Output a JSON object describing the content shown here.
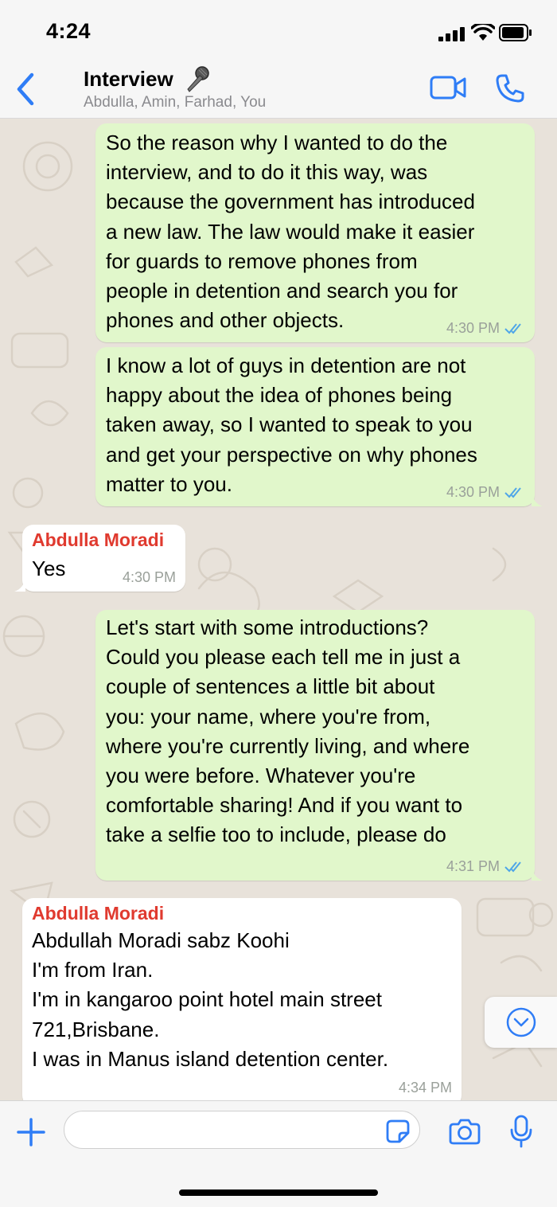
{
  "status_bar": {
    "time": "4:24"
  },
  "header": {
    "back_icon": "chevron-left-icon",
    "title": "Interview",
    "title_emoji_icon": "microphone-icon",
    "subtitle": "Abdulla, Amin, Farhad, You",
    "video_icon": "video-camera-icon",
    "call_icon": "phone-icon"
  },
  "messages": [
    {
      "direction": "outgoing",
      "text": "So the reason why I wanted to do the\ninterview, and to do it this way, was\nbecause the government has introduced\na new law. The law would make it easier\nfor guards to remove phones from\npeople in detention and search you for\nphones and other objects.",
      "time": "4:30 PM",
      "status": "read"
    },
    {
      "direction": "outgoing",
      "text": "I know a lot of guys in detention are not\nhappy about the idea of phones being\ntaken away, so I wanted to speak to you\nand get your perspective on why phones\nmatter to you.",
      "time": "4:30 PM",
      "status": "read"
    },
    {
      "direction": "incoming",
      "sender": "Abdulla Moradi",
      "text": "Yes",
      "time": "4:30 PM"
    },
    {
      "direction": "outgoing",
      "text": "Let's start with some introductions?\nCould you please each tell me in just a\ncouple of sentences a little bit about\nyou: your name, where you're from,\nwhere you're currently living, and where\nyou were before. Whatever you're\ncomfortable sharing! And if you want to\ntake a selfie too to include, please do",
      "time": "4:31 PM",
      "status": "read"
    },
    {
      "direction": "incoming",
      "sender": "Abdulla Moradi",
      "text": "Abdullah Moradi sabz Koohi\nI'm from Iran.\nI'm in kangaroo point hotel main street\n721,Brisbane.\nI was in Manus island detention center.",
      "time": "4:34 PM"
    }
  ],
  "colors": {
    "accent": "#2f7df6",
    "outgoing_bubble": "#e1f7cb",
    "incoming_bubble": "#ffffff",
    "sender_name": "#e03a2f",
    "read_ticks": "#4fa6e8",
    "chat_background": "#e8e2da"
  },
  "input_bar": {
    "plus_icon": "plus-icon",
    "message_value": "",
    "sticker_icon": "sticker-icon",
    "camera_icon": "camera-icon",
    "voice_icon": "microphone-icon"
  },
  "scroll_button_icon": "chevron-down-circle-icon"
}
